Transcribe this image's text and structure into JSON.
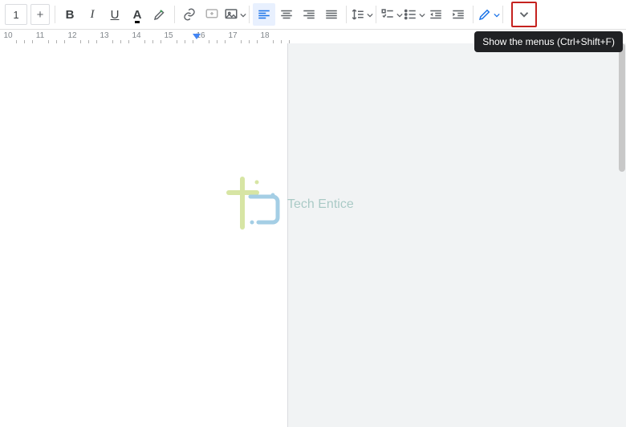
{
  "toolbar": {
    "font_size": "1",
    "plus_label": "+",
    "bold_label": "B",
    "italic_label": "I",
    "underline_label": "U",
    "textcolor_label": "A",
    "pen_dropdown_label": ""
  },
  "tooltip": {
    "show_menus": "Show the menus (Ctrl+Shift+F)"
  },
  "ruler": {
    "numbers": [
      "10",
      "11",
      "12",
      "13",
      "14",
      "15",
      "16",
      "17",
      "18"
    ],
    "marker_at": 245
  },
  "watermark": {
    "text": "Tech Entice"
  },
  "colors": {
    "accent": "#1a73e8",
    "highlight_border": "#c5221f",
    "tooltip_bg": "#202124"
  }
}
